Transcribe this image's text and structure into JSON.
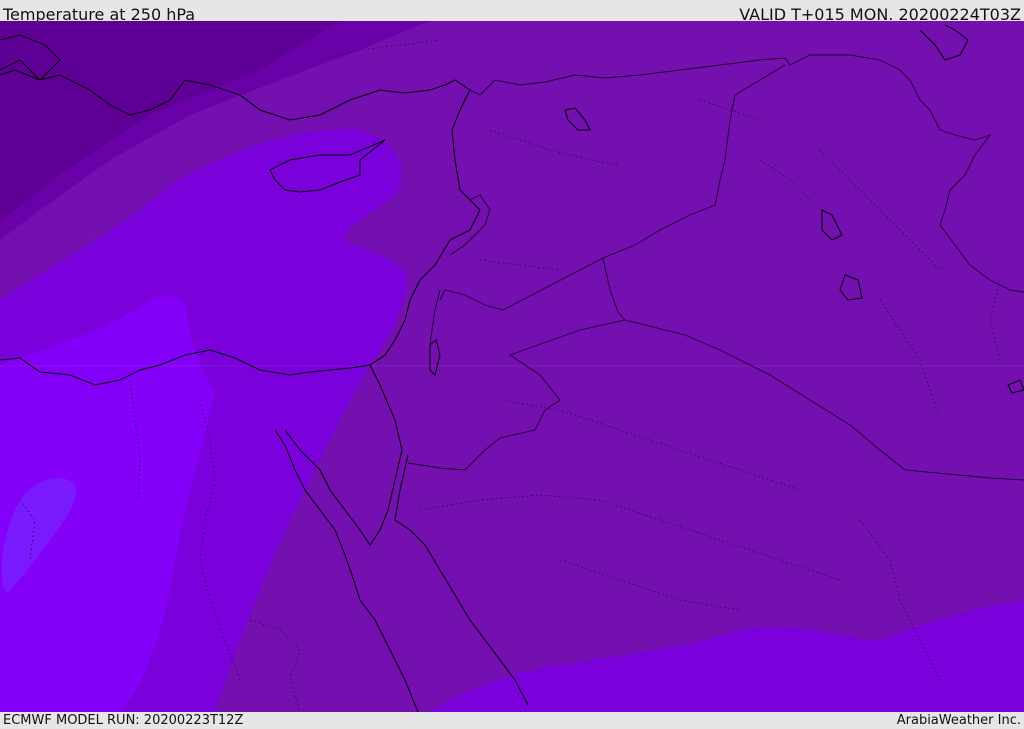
{
  "header": {
    "title": "Temperature at 250 hPa",
    "valid": "VALID T+015 MON. 20200224T03Z"
  },
  "footer": {
    "model_run": "ECMWF MODEL RUN: 20200223T12Z",
    "credit": "ArabiaWeather Inc."
  },
  "map": {
    "colors": {
      "band_darkest": "#5e0096",
      "band_dark": "#6a00a8",
      "band_base": "#7510b0",
      "band_mid": "#7a00dc",
      "band_bright": "#8500f8",
      "band_brightest": "#7a1aff",
      "coastline": "#000000",
      "border": "#1a0030"
    }
  }
}
